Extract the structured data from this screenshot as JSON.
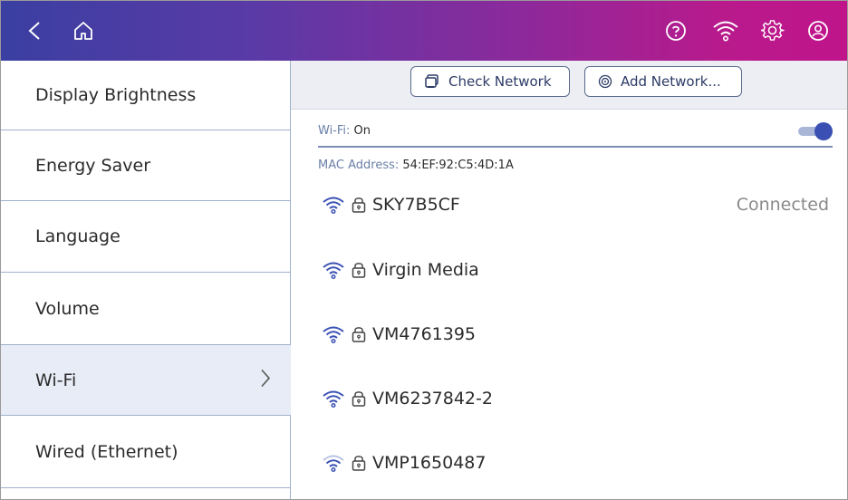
{
  "topbar": {
    "back_icon": "back-arrow-icon",
    "home_icon": "home-icon",
    "right_icons": [
      "help-icon",
      "wifi-icon",
      "settings-icon",
      "account-icon"
    ]
  },
  "sidebar": {
    "items": [
      {
        "label": "Display Brightness"
      },
      {
        "label": "Energy Saver"
      },
      {
        "label": "Language"
      },
      {
        "label": "Volume"
      },
      {
        "label": "Wi-Fi",
        "active": true
      },
      {
        "label": "Wired (Ethernet)"
      }
    ]
  },
  "toolbar": {
    "check_network_label": "Check Network",
    "add_network_label": "Add Network..."
  },
  "wifi": {
    "label": "Wi-Fi:",
    "value": "On",
    "enabled": true,
    "mac_label": "MAC Address:",
    "mac_value": "54:EF:92:C5:4D:1A"
  },
  "networks": [
    {
      "name": "SKY7B5CF",
      "status": "Connected",
      "secured": true,
      "signal": "strong"
    },
    {
      "name": "Virgin Media",
      "status": "",
      "secured": true,
      "signal": "strong"
    },
    {
      "name": "VM4761395",
      "status": "",
      "secured": true,
      "signal": "strong"
    },
    {
      "name": "VM6237842-2",
      "status": "",
      "secured": true,
      "signal": "strong"
    },
    {
      "name": "VMP1650487",
      "status": "",
      "secured": true,
      "signal": "weak"
    }
  ],
  "colors": {
    "topbar_start": "#3b3fa2",
    "topbar_end": "#c0148a",
    "accent": "#3a51b3",
    "active_row": "#e8ecf6",
    "divider": "#9fb1cc"
  }
}
